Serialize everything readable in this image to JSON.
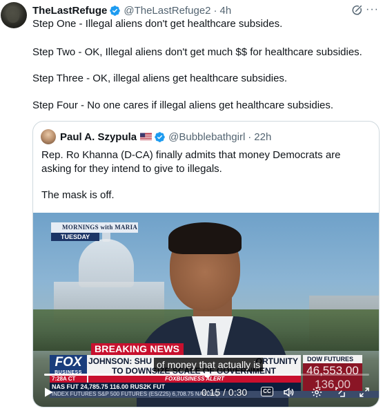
{
  "tweet": {
    "author_name": "TheLastRefuge",
    "author_handle": "@TheLastRefuge2",
    "separator": "·",
    "time": "4h",
    "more_label": "···",
    "lines": [
      "Step One - Illegal aliens don't get healthcare subsides.",
      "Step Two - OK, Illegal aliens don't get much $$ for healthcare subsidies.",
      "Step Three - OK, illegal aliens get healthcare subsidies.",
      "Step Four - No one cares if illegal aliens get healthcare subsidies."
    ]
  },
  "quote": {
    "author_name": "Paul A. Szypula",
    "author_handle": "@Bubblebathgirl",
    "separator": "·",
    "time": "22h",
    "lines": [
      "Rep. Ro Khanna (D-CA) finally admits that money Democrats are",
      "asking for they intend to give to illegals.",
      "The mask is off."
    ]
  },
  "video": {
    "show_name": "MORNINGS with MARIA",
    "show_day": "TUESDAY",
    "breaking": "BREAKING NEWS",
    "network_logo": "FOX",
    "network_sub": "BUSINESS",
    "headline_line1": "JOHNSON: SHU",
    "headline_line1_end": "ORTUNITY",
    "headline_line2": "TO DOWNSIZE SCALE OF GOVERNMENT",
    "local_time": "7:28A CT",
    "alert": "FOXBUSINESS ALERT",
    "dow_label": "DOW FUTURES",
    "dow_value": "46,553.00",
    "dow_change": "136.00",
    "ticker": "NAS FUT  24,785.75  116.00  RUS2K FUT",
    "index_ticker": "INDEX FUTURES  S&P 500 FUTURES (ES/Z25)  6,708.75  NASDAQ",
    "caption": "of money that actually is",
    "timecode": "0:15 / 0:30",
    "progress_fraction": 0.5,
    "cc_label": "CC"
  },
  "colors": {
    "verified": "#1d9bf0",
    "text_primary": "#0f1419",
    "text_secondary": "#536471",
    "border": "#cfd9de",
    "breaking_red": "#c8102e",
    "fox_blue": "#1a3d7c"
  },
  "icons": [
    "verified-badge-icon",
    "grok-icon",
    "more-icon",
    "us-flag-icon",
    "play-icon",
    "volume-icon",
    "settings-icon",
    "minimize-icon",
    "fullscreen-icon",
    "captions-icon"
  ]
}
